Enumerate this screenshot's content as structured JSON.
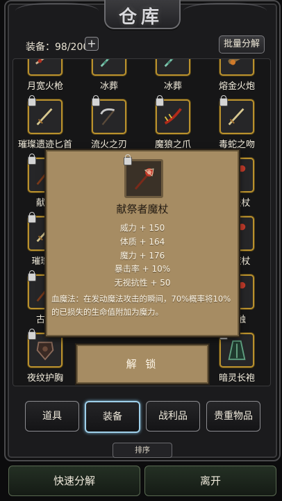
{
  "window": {
    "title": "仓库"
  },
  "header": {
    "capacity_label": "装备：98/200",
    "add_label": "+",
    "batch_label": "批量分解"
  },
  "grid": {
    "rows": [
      [
        {
          "name": "月宽火枪",
          "icon": "gun-icon"
        },
        {
          "name": "冰葬",
          "icon": "ice-blade-icon"
        },
        {
          "name": "冰葬",
          "icon": "ice-blade-icon"
        },
        {
          "name": "熔金火炮",
          "icon": "cannon-icon"
        }
      ],
      [
        {
          "name": "璀璨遗迹匕首",
          "icon": "dagger-icon"
        },
        {
          "name": "流火之刃",
          "icon": "scythe-icon"
        },
        {
          "name": "魔狼之爪",
          "icon": "claw-icon"
        },
        {
          "name": "毒蛇之吻",
          "icon": "dagger-icon"
        }
      ],
      [
        {
          "name": "献祭",
          "icon": "staff-icon"
        },
        {
          "name": "",
          "icon": ""
        },
        {
          "name": "",
          "icon": ""
        },
        {
          "name": "迹法杖",
          "icon": "staff-icon"
        }
      ],
      [
        {
          "name": "璀璨遗",
          "icon": "dagger-icon"
        },
        {
          "name": "",
          "icon": ""
        },
        {
          "name": "",
          "icon": ""
        },
        {
          "name": "刺魔杖",
          "icon": "staff-icon"
        }
      ],
      [
        {
          "name": "古精",
          "icon": "staff-icon"
        },
        {
          "name": "",
          "icon": ""
        },
        {
          "name": "",
          "icon": ""
        },
        {
          "name": "之触",
          "icon": "staff-icon"
        }
      ],
      [
        {
          "name": "夜纹护胸",
          "icon": "armor-icon"
        },
        {
          "name": "",
          "icon": ""
        },
        {
          "name": "",
          "icon": ""
        },
        {
          "name": "暗灵长袍",
          "icon": "robe-icon"
        }
      ]
    ]
  },
  "popup": {
    "item_name": "献祭者魔杖",
    "icon": "staff-icon",
    "stats": [
      "威力 + 150",
      "体质 + 164",
      "魔力 + 176",
      "暴击率 + 10%",
      "无视抗性 + 50"
    ],
    "skill_text": "血魔法：在发动魔法攻击的瞬间，70%概率将10%的已损失的生命值附加为魔力。",
    "unlock_label": "解 锁"
  },
  "tabs": [
    {
      "label": "道具"
    },
    {
      "label": "装备",
      "active": true
    },
    {
      "label": "战利品"
    },
    {
      "label": "贵重物品"
    }
  ],
  "sort_label": "排序",
  "footer": {
    "left_label": "快速分解",
    "right_label": "离开"
  },
  "colors": {
    "frame_gold": "#b9912e",
    "popup_bg": "#a68c63",
    "active_tab": "#9fd0ea"
  }
}
